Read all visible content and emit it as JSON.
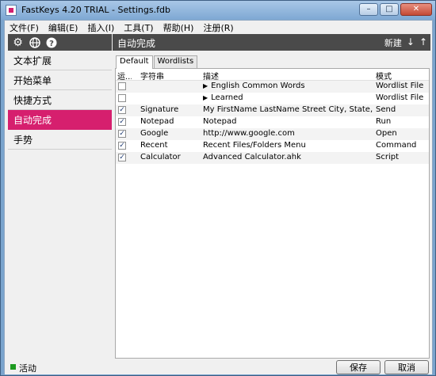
{
  "window": {
    "title": "FastKeys 4.20 TRIAL - Settings.fdb",
    "controls": [
      "minimize-icon",
      "maximize-icon",
      "close-icon"
    ]
  },
  "menu": [
    "文件(F)",
    "编辑(E)",
    "插入(I)",
    "工具(T)",
    "帮助(H)",
    "注册(R)"
  ],
  "sidebar": {
    "tool_icons": [
      "gear-icon",
      "globe-icon",
      "help-icon"
    ],
    "items": [
      {
        "label": "文本扩展"
      },
      {
        "label": "开始菜单"
      },
      {
        "label": "快捷方式"
      },
      {
        "label": "自动完成"
      },
      {
        "label": "手势"
      }
    ],
    "active_index": 3
  },
  "main": {
    "title": "自动完成",
    "new_label": "新建",
    "down_arrow": "↓",
    "up_arrow": "↑",
    "tabs": [
      {
        "label": "Default"
      },
      {
        "label": "Wordlists"
      }
    ],
    "columns": [
      "运...",
      "字符串",
      "描述",
      "模式"
    ],
    "rows": [
      {
        "checked": "",
        "abbr": "",
        "desc": "English Common Words",
        "mode": "Wordlist File",
        "expand": "▶"
      },
      {
        "checked": "",
        "abbr": "",
        "desc": "Learned",
        "mode": "Wordlist File",
        "expand": "▶"
      },
      {
        "checked": "✓",
        "abbr": "Signature",
        "desc": "My FirstName LastName Street City, State, Zip E...",
        "mode": "Send",
        "expand": ""
      },
      {
        "checked": "✓",
        "abbr": "Notepad",
        "desc": "Notepad",
        "mode": "Run",
        "expand": ""
      },
      {
        "checked": "✓",
        "abbr": "Google",
        "desc": "http://www.google.com",
        "mode": "Open",
        "expand": ""
      },
      {
        "checked": "✓",
        "abbr": "Recent",
        "desc": "Recent Files/Folders Menu",
        "mode": "Command",
        "expand": ""
      },
      {
        "checked": "✓",
        "abbr": "Calculator",
        "desc": "Advanced Calculator.ahk",
        "mode": "Script",
        "expand": ""
      }
    ]
  },
  "status": {
    "text": "活动",
    "indicator_color": "#1c9a1f",
    "save_label": "保存",
    "cancel_label": "取消"
  },
  "colors": {
    "accent": "#d61f6e",
    "header_bg": "#4a4a4a",
    "frame": "#7aa4cd"
  }
}
